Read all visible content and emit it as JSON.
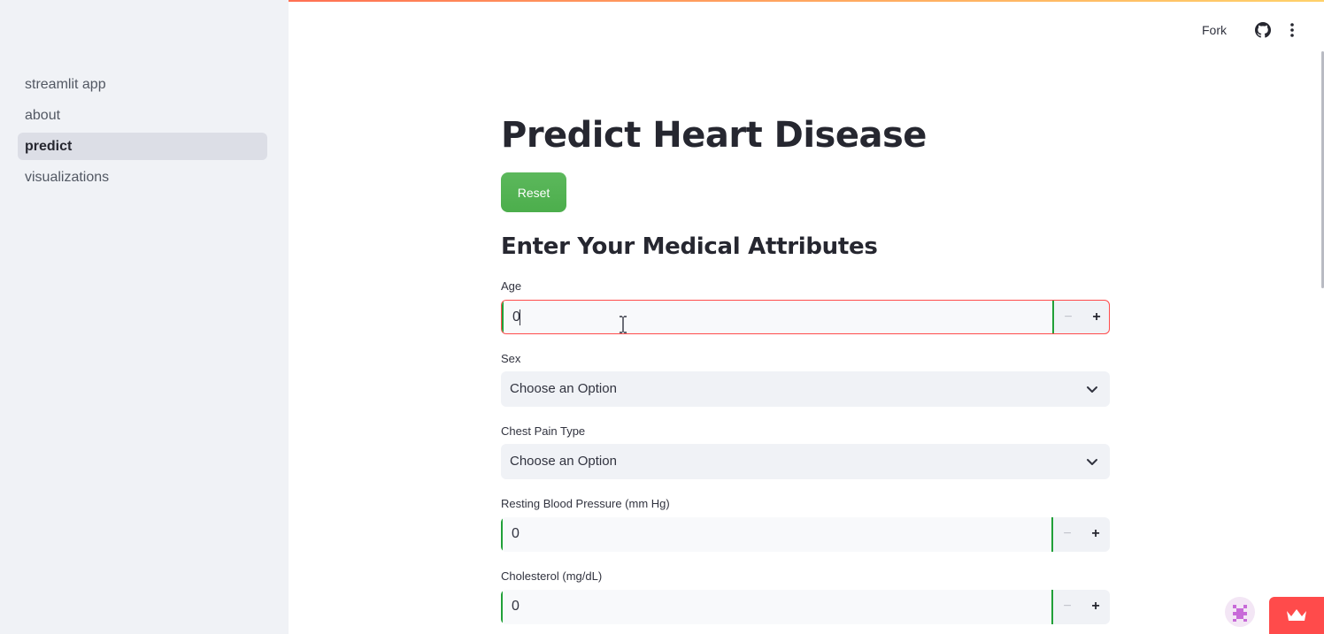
{
  "sidebar": {
    "items": [
      {
        "label": "streamlit app",
        "active": false
      },
      {
        "label": "about",
        "active": false
      },
      {
        "label": "predict",
        "active": true
      },
      {
        "label": "visualizations",
        "active": false
      }
    ]
  },
  "header": {
    "fork_label": "Fork",
    "github_icon": "github-icon",
    "menu_icon": "kebab-menu-icon"
  },
  "main": {
    "title": "Predict Heart Disease",
    "reset_label": "Reset",
    "section_heading": "Enter Your Medical Attributes",
    "fields": {
      "age": {
        "label": "Age",
        "value": "0",
        "minus": "−",
        "plus": "+"
      },
      "sex": {
        "label": "Sex",
        "value": "Choose an Option"
      },
      "chest_pain": {
        "label": "Chest Pain Type",
        "value": "Choose an Option"
      },
      "resting_bp": {
        "label": "Resting Blood Pressure (mm Hg)",
        "value": "0",
        "minus": "−",
        "plus": "+"
      },
      "cholesterol": {
        "label": "Cholesterol (mg/dL)",
        "value": "0",
        "minus": "−",
        "plus": "+"
      }
    }
  },
  "colors": {
    "accent": "#ff4b4b",
    "focus_border": "#21a038",
    "button_green": "#5cb85c"
  }
}
